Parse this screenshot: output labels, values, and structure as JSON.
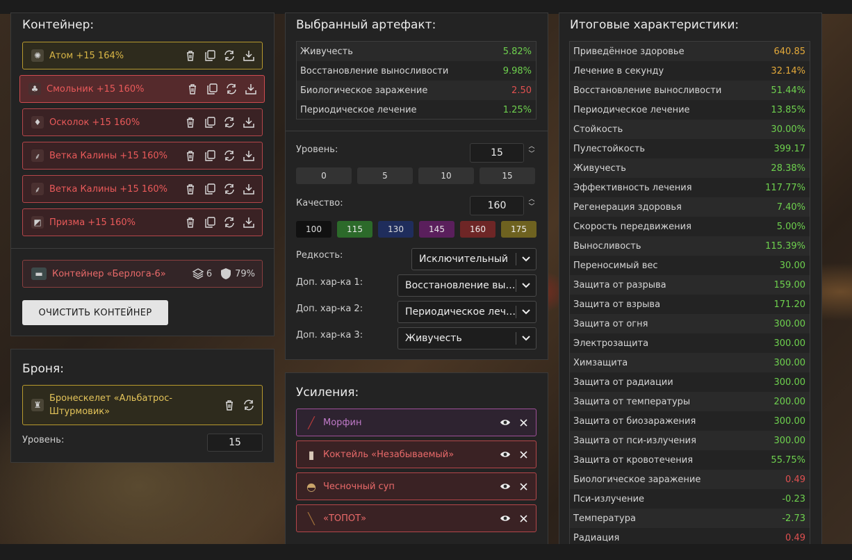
{
  "container": {
    "title": "Контейнер:",
    "slots": [
      {
        "name": "Атом +15 164%",
        "style": "gold",
        "icon": "atom-artifact-icon"
      },
      {
        "name": "Смольник +15 160%",
        "style": "red-selected",
        "icon": "smolnik-artifact-icon"
      },
      {
        "name": "Осколок +15 160%",
        "style": "red",
        "icon": "shard-artifact-icon"
      },
      {
        "name": "Ветка Калины +15 160%",
        "style": "red",
        "icon": "viburnum-branch-icon"
      },
      {
        "name": "Ветка Калины +15 160%",
        "style": "red",
        "icon": "viburnum-branch-icon"
      },
      {
        "name": "Призма +15 160%",
        "style": "red",
        "icon": "prism-artifact-icon"
      }
    ],
    "container_item": {
      "name": "Контейнер «Берлога-6»",
      "slots": "6",
      "protection": "79%"
    },
    "clear_label": "ОЧИСТИТЬ КОНТЕЙНЕР"
  },
  "armor": {
    "title": "Броня:",
    "item_name": "Бронескелет «Альбатрос-Штурмовик»",
    "level_label": "Уровень:",
    "level": "15"
  },
  "artifact": {
    "title": "Выбранный артефакт:",
    "stats": [
      {
        "label": "Живучесть",
        "value": "5.82%",
        "color": "#6ed14e"
      },
      {
        "label": "Восстановление выносливости",
        "value": "9.98%",
        "color": "#6ed14e"
      },
      {
        "label": "Биологическое заражение",
        "value": "2.50",
        "color": "#e05050"
      },
      {
        "label": "Периодическое лечение",
        "value": "1.25%",
        "color": "#6ed14e"
      }
    ],
    "level_label": "Уровень:",
    "level": "15",
    "level_presets": [
      "0",
      "5",
      "10",
      "15"
    ],
    "quality_label": "Качество:",
    "quality": "160",
    "quality_presets": [
      {
        "v": "100",
        "bg": "#111111",
        "fg": "#dddddd"
      },
      {
        "v": "115",
        "bg": "#2c6a2a",
        "fg": "#e8e8e8"
      },
      {
        "v": "130",
        "bg": "#1f2d5c",
        "fg": "#dddddd"
      },
      {
        "v": "145",
        "bg": "#5a1f5c",
        "fg": "#e8e8e8"
      },
      {
        "v": "160",
        "bg": "#6e2626",
        "fg": "#eeeeee"
      },
      {
        "v": "175",
        "bg": "#6e6220",
        "fg": "#eeeeee"
      }
    ],
    "rarity_label": "Редкость:",
    "rarity": "Исключительный",
    "extra1_label": "Доп. хар-ка 1:",
    "extra1": "Восстановление выносливости",
    "extra2_label": "Доп. хар-ка 2:",
    "extra2": "Периодическое лечение",
    "extra3_label": "Доп. хар-ка 3:",
    "extra3": "Живучесть"
  },
  "boosts": {
    "title": "Усиления:",
    "items": [
      {
        "name": "Морфин",
        "color": "#c07ac9",
        "border": "#a0509a",
        "bg": "#2e2330",
        "icon": "morphine-syringe-icon"
      },
      {
        "name": "Коктейль «Незабываемый»",
        "color": "#ea6a6a",
        "border": "#b5464a",
        "bg": "#3a2224",
        "icon": "cocktail-bottle-icon"
      },
      {
        "name": "Чесночный суп",
        "color": "#ea6a6a",
        "border": "#b5464a",
        "bg": "#3a2224",
        "icon": "soup-pot-icon"
      },
      {
        "name": "«ТОПОТ»",
        "color": "#ea6a6a",
        "border": "#b5464a",
        "bg": "#3a2224",
        "icon": "stimulator-icon"
      }
    ]
  },
  "totals": {
    "title": "Итоговые характеристики:",
    "rows": [
      {
        "label": "Приведённое здоровье",
        "value": "640.85",
        "color": "#e3a93a"
      },
      {
        "label": "Лечение в секунду",
        "value": "32.14%",
        "color": "#e3a93a"
      },
      {
        "label": "Восстановление выносливости",
        "value": "51.44%",
        "color": "#6ed14e"
      },
      {
        "label": "Периодическое лечение",
        "value": "13.85%",
        "color": "#6ed14e"
      },
      {
        "label": "Стойкость",
        "value": "30.00%",
        "color": "#6ed14e"
      },
      {
        "label": "Пулестойкость",
        "value": "399.17",
        "color": "#6ed14e"
      },
      {
        "label": "Живучесть",
        "value": "28.38%",
        "color": "#6ed14e"
      },
      {
        "label": "Эффективность лечения",
        "value": "117.77%",
        "color": "#6ed14e"
      },
      {
        "label": "Регенерация здоровья",
        "value": "7.40%",
        "color": "#6ed14e"
      },
      {
        "label": "Скорость передвижения",
        "value": "5.00%",
        "color": "#6ed14e"
      },
      {
        "label": "Выносливость",
        "value": "115.39%",
        "color": "#6ed14e"
      },
      {
        "label": "Переносимый вес",
        "value": "30.00",
        "color": "#6ed14e"
      },
      {
        "label": "Защита от разрыва",
        "value": "159.00",
        "color": "#6ed14e"
      },
      {
        "label": "Защита от взрыва",
        "value": "171.20",
        "color": "#6ed14e"
      },
      {
        "label": "Защита от огня",
        "value": "300.00",
        "color": "#6ed14e"
      },
      {
        "label": "Электрозащита",
        "value": "300.00",
        "color": "#6ed14e"
      },
      {
        "label": "Химзащита",
        "value": "300.00",
        "color": "#6ed14e"
      },
      {
        "label": "Защита от радиации",
        "value": "300.00",
        "color": "#6ed14e"
      },
      {
        "label": "Защита от температуры",
        "value": "200.00",
        "color": "#6ed14e"
      },
      {
        "label": "Защита от биозаражения",
        "value": "300.00",
        "color": "#6ed14e"
      },
      {
        "label": "Защита от пси-излучения",
        "value": "300.00",
        "color": "#6ed14e"
      },
      {
        "label": "Защита от кровотечения",
        "value": "55.75%",
        "color": "#6ed14e"
      },
      {
        "label": "Биологическое заражение",
        "value": "0.49",
        "color": "#e05050"
      },
      {
        "label": "Пси-излучение",
        "value": "-0.23",
        "color": "#6ed14e"
      },
      {
        "label": "Температура",
        "value": "-2.73",
        "color": "#6ed14e"
      },
      {
        "label": "Радиация",
        "value": "0.49",
        "color": "#e05050"
      }
    ]
  }
}
